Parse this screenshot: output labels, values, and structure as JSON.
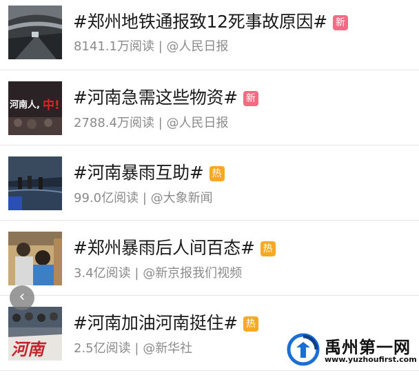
{
  "items": [
    {
      "title": "#郑州地铁通报致12死事故原因#",
      "badge": "新",
      "reads": "8141.1万阅读",
      "source": "@人民日报",
      "thumb": "subway-tunnel-image",
      "badge_color": "#f56a82"
    },
    {
      "title": "#河南急需这些物资#",
      "badge": "新",
      "reads": "2788.4万阅读",
      "source": "@人民日报",
      "thumb": "henan-poster-image",
      "thumb_text": "河南人,",
      "thumb_text2": "中!",
      "badge_color": "#f56a82"
    },
    {
      "title": "#河南暴雨互助#",
      "badge": "热",
      "reads": "99.0亿阅读",
      "source": "@大象新闻",
      "thumb": "flooded-tunnel-image",
      "badge_color": "#f7a825"
    },
    {
      "title": "#郑州暴雨后人间百态#",
      "badge": "热",
      "reads": "3.4亿阅读",
      "source": "@新京报我们视频",
      "thumb": "people-on-subway-image",
      "badge_color": "#f7a825"
    },
    {
      "title": "#河南加油河南挺住#",
      "badge": "热",
      "reads": "2.5亿阅读",
      "source": "@新华社",
      "thumb": "rescue-crowd-image",
      "thumb_text": "河南",
      "badge_color": "#f7a825"
    }
  ],
  "separator": "|",
  "back_button": {
    "icon": "chevron-left-icon",
    "glyph": "‹"
  },
  "watermark": {
    "name": "禹州第一网",
    "url": "www.yuzhoufirst.com",
    "logo": "yuzhou-logo-icon"
  }
}
